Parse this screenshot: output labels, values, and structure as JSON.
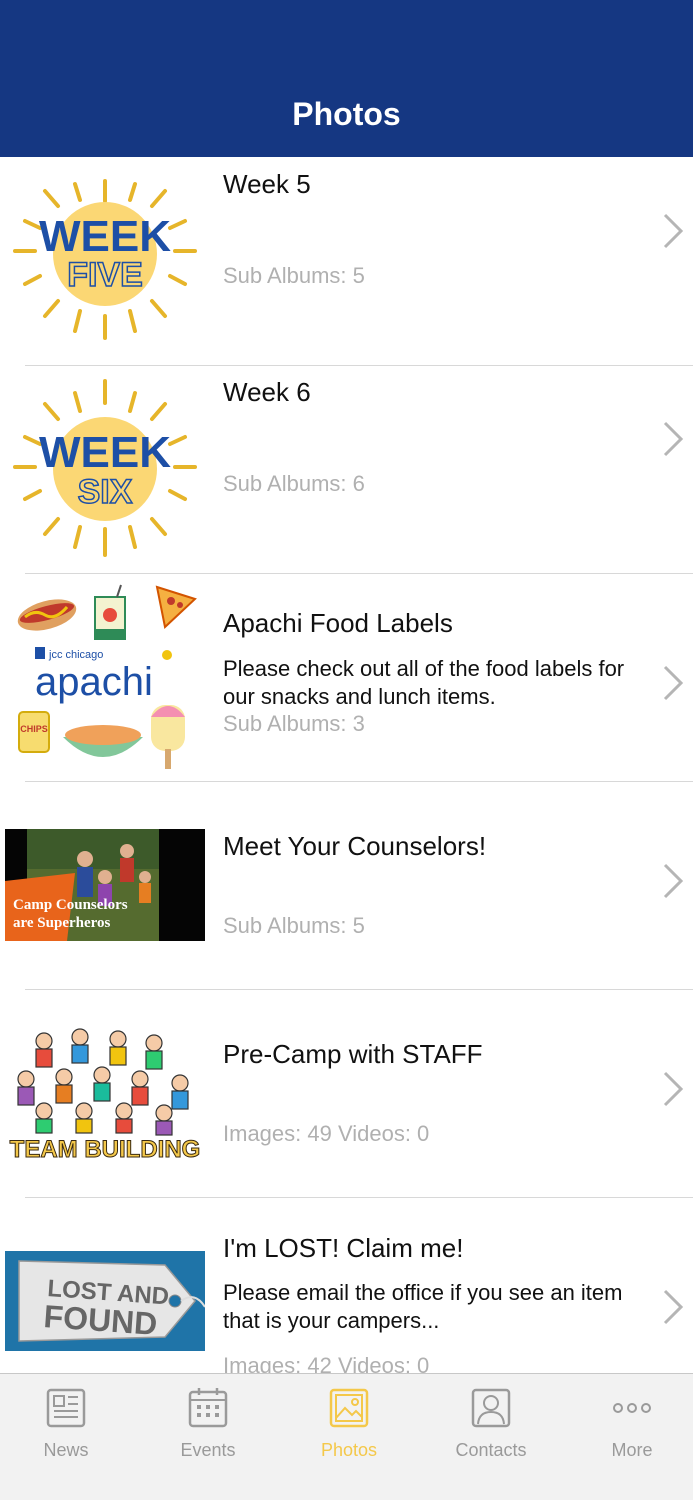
{
  "header": {
    "title": "Photos"
  },
  "albums": [
    {
      "title": "Week 5",
      "description": "",
      "meta": "Sub Albums: 5",
      "thumb_text": [
        "WEEK",
        "FIVE"
      ]
    },
    {
      "title": "Week 6",
      "description": "",
      "meta": "Sub Albums: 6",
      "thumb_text": [
        "WEEK",
        "SIX"
      ]
    },
    {
      "title": "Apachi Food Labels",
      "description": "Please check out all of the food labels for our snacks and lunch items.",
      "meta": "Sub Albums: 3",
      "thumb_text": [
        "jcc chicago",
        "apachi",
        "CHIPS"
      ]
    },
    {
      "title": "Meet Your Counselors!",
      "description": "",
      "meta": "Sub Albums: 5",
      "thumb_text": [
        "Camp Counselors",
        "are Superheros"
      ]
    },
    {
      "title": "Pre-Camp with STAFF",
      "description": "",
      "meta": "Images: 49 Videos: 0",
      "thumb_text": [
        "TEAM BUILDING"
      ]
    },
    {
      "title": "I'm LOST!  Claim me!",
      "description": "Please email the office if you see an item that is your campers...",
      "meta": "Images: 42 Videos: 0",
      "thumb_text": [
        "LOST AND",
        "FOUND"
      ]
    }
  ],
  "tabs": [
    {
      "label": "News",
      "icon": "newspaper-icon",
      "active": false
    },
    {
      "label": "Events",
      "icon": "calendar-icon",
      "active": false
    },
    {
      "label": "Photos",
      "icon": "photo-icon",
      "active": true
    },
    {
      "label": "Contacts",
      "icon": "contact-icon",
      "active": false
    },
    {
      "label": "More",
      "icon": "more-dots-icon",
      "active": false
    }
  ],
  "colors": {
    "header_bg": "#153782",
    "active_tab": "#f4c84a",
    "inactive_tab": "#9a9a9a",
    "meta_text": "#b0b0b0"
  }
}
